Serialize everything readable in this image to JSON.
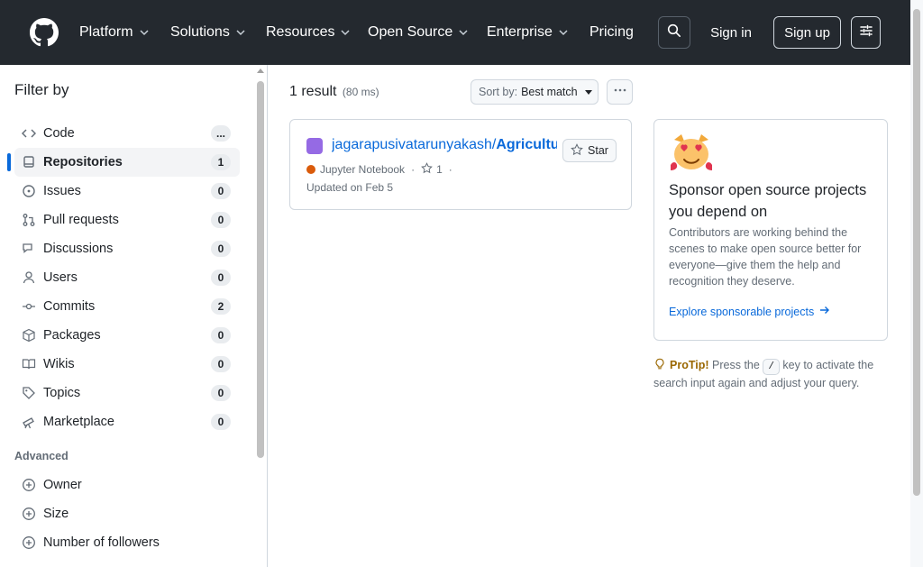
{
  "header": {
    "nav": [
      {
        "label": "Platform"
      },
      {
        "label": "Solutions"
      },
      {
        "label": "Resources"
      },
      {
        "label": "Open Source"
      },
      {
        "label": "Enterprise"
      },
      {
        "label": "Pricing"
      }
    ],
    "sign_in": "Sign in",
    "sign_up": "Sign up",
    "icons": {
      "logo": "github-logo-icon",
      "search": "search-icon",
      "settings": "sliders-icon"
    }
  },
  "sidebar": {
    "title": "Filter by",
    "filters": [
      {
        "label": "Code",
        "count": "...",
        "icon": "code-icon"
      },
      {
        "label": "Repositories",
        "count": "1",
        "icon": "repo-icon",
        "selected": true
      },
      {
        "label": "Issues",
        "count": "0",
        "icon": "issue-icon"
      },
      {
        "label": "Pull requests",
        "count": "0",
        "icon": "pull-request-icon"
      },
      {
        "label": "Discussions",
        "count": "0",
        "icon": "discussion-icon"
      },
      {
        "label": "Users",
        "count": "0",
        "icon": "person-icon"
      },
      {
        "label": "Commits",
        "count": "2",
        "icon": "commit-icon"
      },
      {
        "label": "Packages",
        "count": "0",
        "icon": "package-icon"
      },
      {
        "label": "Wikis",
        "count": "0",
        "icon": "book-icon"
      },
      {
        "label": "Topics",
        "count": "0",
        "icon": "tag-icon"
      },
      {
        "label": "Marketplace",
        "count": "0",
        "icon": "telescope-icon"
      }
    ],
    "advanced_title": "Advanced",
    "advanced": [
      {
        "label": "Owner",
        "icon": "plus-circle-icon"
      },
      {
        "label": "Size",
        "icon": "plus-circle-icon"
      },
      {
        "label": "Number of followers",
        "icon": "plus-circle-icon"
      }
    ]
  },
  "main": {
    "result_count": "1 result",
    "result_time": "(80 ms)",
    "sort_label": "Sort by:",
    "sort_value": "Best match",
    "result": {
      "repo_owner": "jagarapusivatarunyakash/",
      "repo_name": "Agriculture",
      "language": "Jupyter Notebook",
      "language_color": "#DA5B0B",
      "stars": "1",
      "updated": "Updated on Feb 5",
      "star_button": "Star"
    },
    "sponsor": {
      "title": "Sponsor open source projects you depend on",
      "description": "Contributors are working behind the scenes to make open source better for everyone—give them the help and recognition they deserve.",
      "link": "Explore sponsorable projects"
    },
    "protip": {
      "label": "ProTip!",
      "before": "Press the",
      "key": "/",
      "after": "key to activate the search input again and adjust your query."
    }
  },
  "colors": {
    "header_bg": "#24292f",
    "link": "#0969da",
    "muted": "#636c76",
    "accent": "#0969da"
  }
}
